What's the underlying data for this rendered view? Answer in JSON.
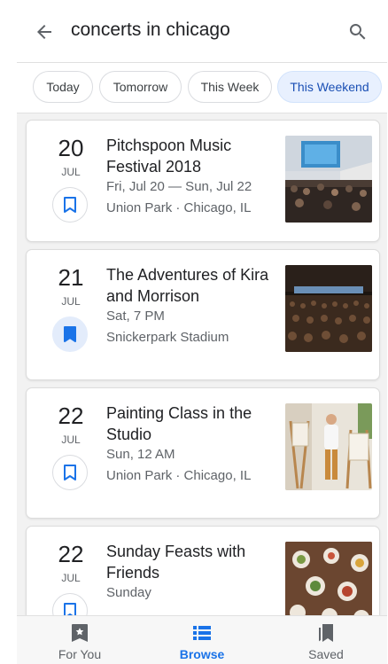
{
  "search": {
    "query": "concerts in chicago"
  },
  "filters": [
    {
      "label": "Today",
      "active": false
    },
    {
      "label": "Tomorrow",
      "active": false
    },
    {
      "label": "This Week",
      "active": false
    },
    {
      "label": "This Weekend",
      "active": true
    }
  ],
  "events": [
    {
      "day": "20",
      "month": "JUL",
      "title": "Pitchspoon Music Festival 2018",
      "when": "Fri, Jul 20 — Sun, Jul 22",
      "where": "Union Park · Chicago, IL",
      "saved": false,
      "image": "festival-crowd-photo"
    },
    {
      "day": "21",
      "month": "JUL",
      "title": "The Adventures of Kira and Morrison",
      "when": "Sat, 7 PM",
      "where": "Snickerpark Stadium",
      "saved": true,
      "image": "concert-hall-audience-photo"
    },
    {
      "day": "22",
      "month": "JUL",
      "title": "Painting Class in the Studio",
      "when": "Sun, 12 AM",
      "where": "Union Park · Chicago, IL",
      "saved": false,
      "image": "painting-studio-photo"
    },
    {
      "day": "22",
      "month": "JUL",
      "title": "Sunday Feasts with Friends",
      "when": "Sunday",
      "where": "",
      "saved": false,
      "image": "food-table-photo"
    }
  ],
  "bottom_nav": [
    {
      "label": "For You",
      "icon": "for-you-icon",
      "active": false
    },
    {
      "label": "Browse",
      "icon": "browse-list-icon",
      "active": true
    },
    {
      "label": "Saved",
      "icon": "saved-bookmarks-icon",
      "active": false
    }
  ],
  "colors": {
    "accent": "#1a73e8",
    "chip_active_bg": "#e8f0fe",
    "saved_bg": "#e3ecfb"
  }
}
